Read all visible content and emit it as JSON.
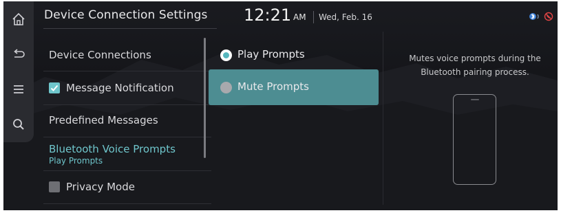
{
  "header": {
    "title": "Device Connection Settings",
    "time": "12:21",
    "ampm": "AM",
    "date": "Wed, Feb. 16"
  },
  "rail": {
    "icons": [
      "home-icon",
      "back-icon",
      "menu-icon",
      "search-icon"
    ]
  },
  "menu": {
    "device_connections": "Device Connections",
    "message_notification": "Message Notification",
    "message_notification_checked": true,
    "predefined_messages": "Predefined Messages",
    "bluetooth_voice_prompts": "Bluetooth Voice Prompts",
    "bluetooth_voice_prompts_value": "Play Prompts",
    "privacy_mode": "Privacy Mode",
    "privacy_mode_checked": false
  },
  "options": {
    "play_prompts": "Play Prompts",
    "mute_prompts": "Mute Prompts",
    "selected": "Play Prompts",
    "highlighted": "Mute Prompts"
  },
  "description": {
    "text": "Mutes voice prompts during the Bluetooth pairing process."
  },
  "status": {
    "icons": [
      "bluetooth-audio-icon",
      "phone-muted-icon"
    ]
  },
  "colors": {
    "accent": "#6fc6cc",
    "highlight": "#4d8d92",
    "background": "#16171b"
  }
}
